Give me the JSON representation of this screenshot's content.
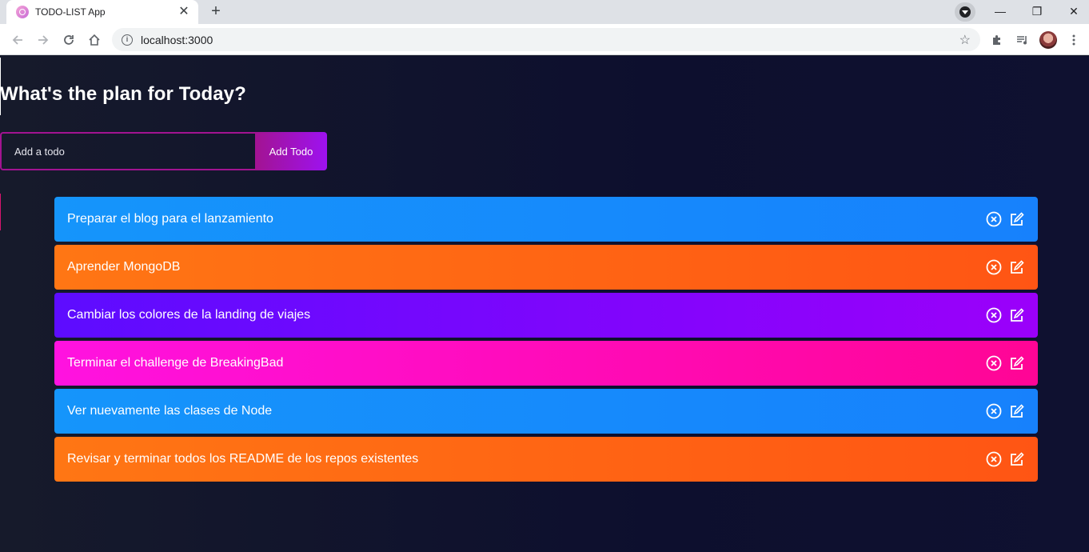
{
  "browser": {
    "tab_title": "TODO-LIST App",
    "tab_close": "✕",
    "new_tab": "+",
    "url": "localhost:3000",
    "window_controls": {
      "minimize": "—",
      "restore": "❐",
      "close": "✕"
    }
  },
  "page": {
    "title": "What's the plan for Today?",
    "input_placeholder": "Add a todo",
    "add_button": "Add Todo"
  },
  "todos": [
    {
      "text": "Preparar el blog para el lanzamiento",
      "color": "#1595fb"
    },
    {
      "text": "Aprender MongoDB",
      "color": "#ff6a14"
    },
    {
      "text": "Cambiar los colores de la landing de viajes",
      "color": "#7a08fc"
    },
    {
      "text": "Terminar el challenge de BreakingBad",
      "color": "#ff0ac0"
    },
    {
      "text": "Ver nuevamente las clases de Node",
      "color": "#1595fb"
    },
    {
      "text": "Revisar y terminar todos los README de los repos existentes",
      "color": "#ff6a14"
    }
  ],
  "icons": {
    "delete": "close-circle-icon",
    "edit": "edit-icon"
  }
}
